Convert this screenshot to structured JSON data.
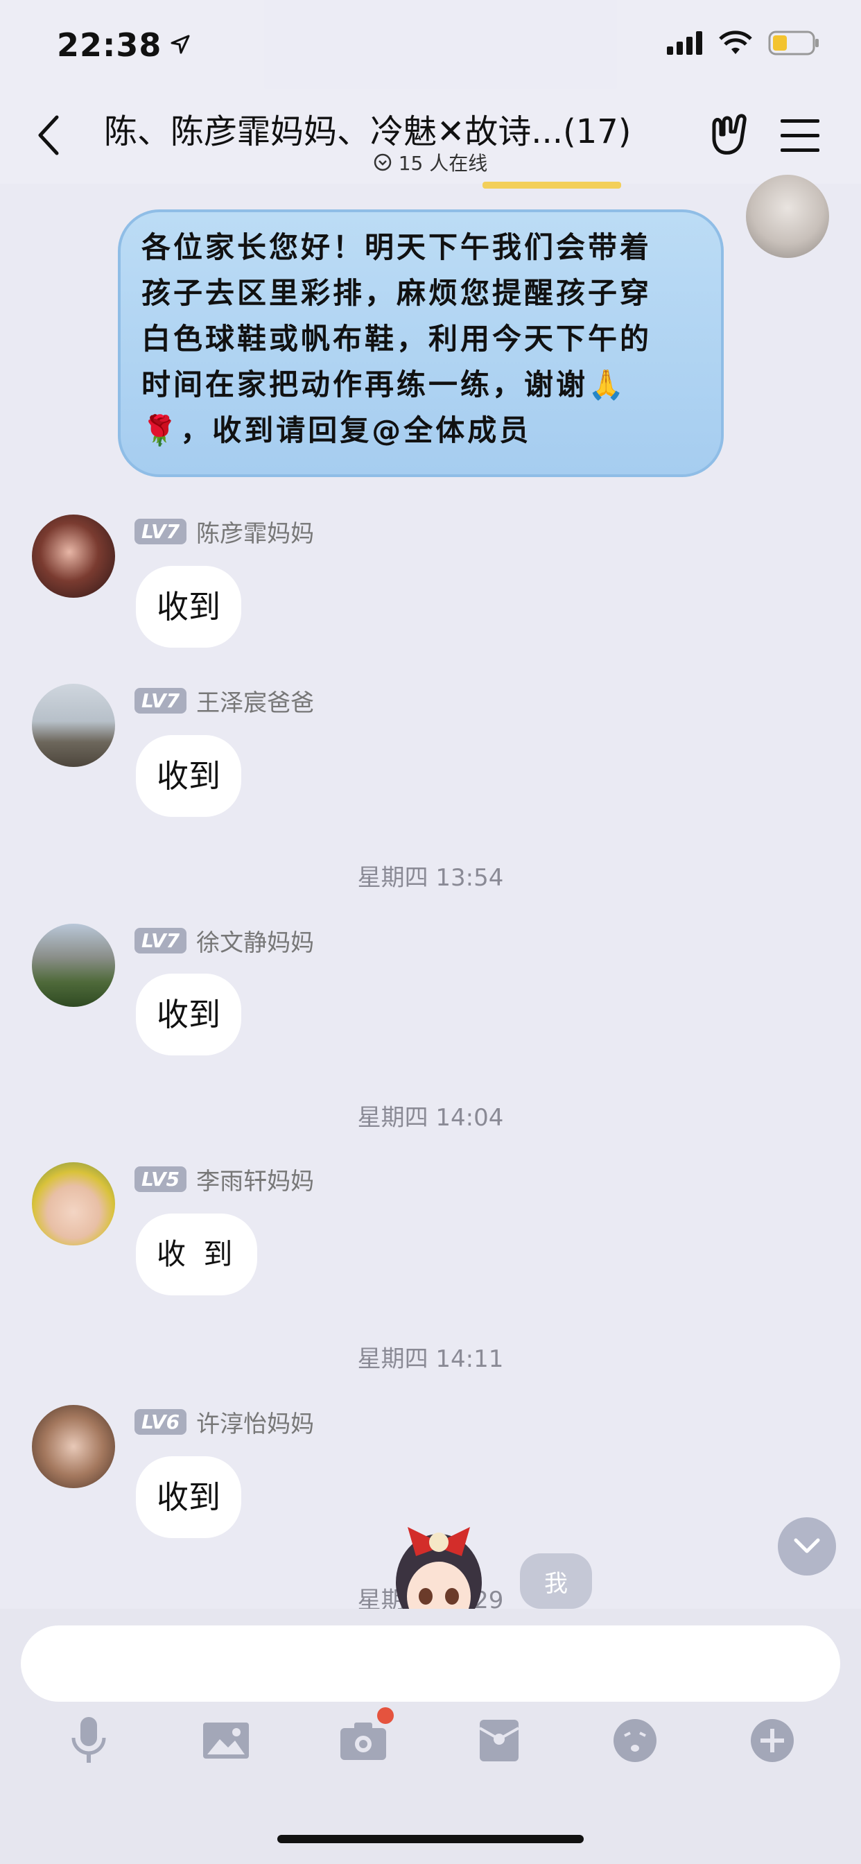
{
  "status_bar": {
    "time": "22:38"
  },
  "header": {
    "title": "陈、陈彦霏妈妈、冷魅✕故诗...(17)",
    "online_text": "15 人在线"
  },
  "announcement": {
    "lines": [
      "各位家长您好！明天下午我们会带着",
      "孩子去区里彩排，麻烦您提醒孩子穿",
      "白色球鞋或帆布鞋，利用今天下午的",
      "时间在家把动作再练一练，谢谢🙏",
      "🌹，收到请回复@全体成员"
    ]
  },
  "messages": [
    {
      "level": "LV7",
      "name": "陈彦霏妈妈",
      "text": "收到"
    },
    {
      "level": "LV7",
      "name": "王泽宸爸爸",
      "text": "收到"
    },
    {
      "level": "LV7",
      "name": "徐文静妈妈",
      "text": "收到"
    },
    {
      "level": "LV5",
      "name": "李雨轩妈妈",
      "text": "收 到"
    },
    {
      "level": "LV6",
      "name": "许淳怡妈妈",
      "text": "收到"
    }
  ],
  "timestamps": [
    "星期四 13:54",
    "星期四 14:04",
    "星期四 14:11",
    "星期四 14:29"
  ],
  "me_badge": "我",
  "colors": {
    "background": "#eaeaf3",
    "bubble": "#ffffff",
    "announcement_bubble": "#a6cdf0",
    "badge": "#a9adbe",
    "notification_dot": "#e5533e"
  }
}
